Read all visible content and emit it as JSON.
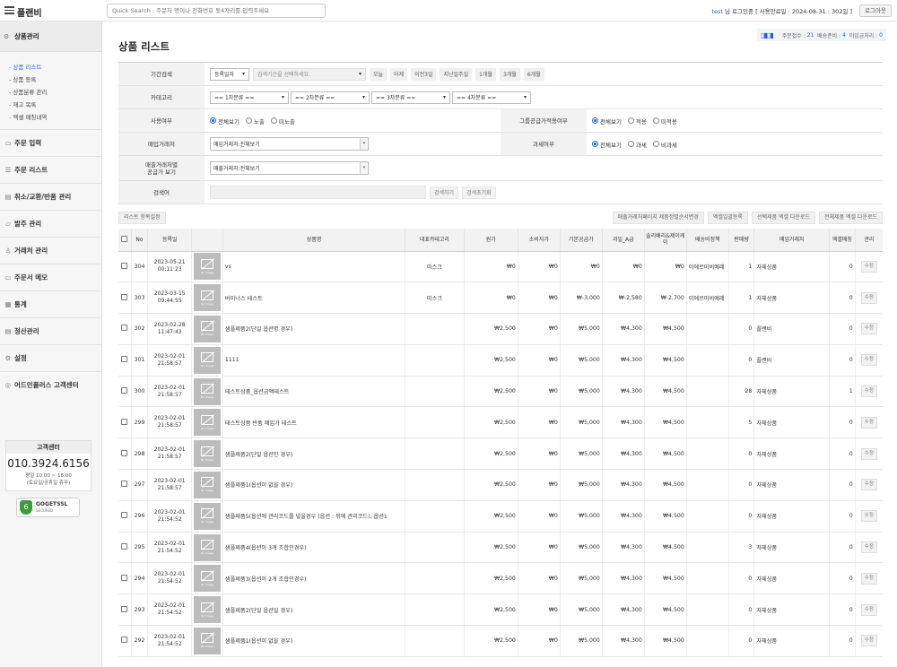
{
  "header": {
    "brand": "플랜비",
    "quick_search_placeholder": "Quick Search : 주문자 명이나 전화번호 뒷4자리를 입력주세요",
    "login_user": "test",
    "login_text": "님 로그인중 [ 사용만료일 : 2024-08-31 : 302일 ]",
    "logout_label": "로그아웃"
  },
  "sidebar": {
    "active_section": "상품관리",
    "sub_items": [
      "- 상품 리스트",
      "- 상품 등록",
      "- 상품분류 관리",
      "- 재고 목록",
      "- 엑셀 매칭내역"
    ],
    "items": [
      {
        "label": "주문 입력",
        "icon": "document-icon"
      },
      {
        "label": "주문 리스트",
        "icon": "list-icon"
      },
      {
        "label": "취소/교환/반품 관리",
        "icon": "return-icon"
      },
      {
        "label": "발주 관리",
        "icon": "order-icon"
      },
      {
        "label": "거래처 관리",
        "icon": "person-icon"
      },
      {
        "label": "주문서 메모",
        "icon": "memo-icon"
      },
      {
        "label": "통계",
        "icon": "chart-icon"
      },
      {
        "label": "정산관리",
        "icon": "calc-icon"
      },
      {
        "label": "설정",
        "icon": "gear-icon"
      },
      {
        "label": "어드민플러스 고객센터",
        "icon": "support-icon"
      }
    ],
    "cs": {
      "title": "고객센터",
      "phone": "010.3924.6156",
      "hours_line1": "평일 10:00 ~ 18:00",
      "hours_line2": "(토요일/공휴일 휴무)"
    },
    "ssl_badge": {
      "name": "GOGETSSL",
      "sub": "SECURED"
    }
  },
  "main": {
    "page_title": "상품 리스트",
    "status": {
      "order_count_label": "주문접수 :",
      "order_count": "21",
      "shipping_label": "배송준비 :",
      "shipping_count": "4",
      "unmatched_label": "미입금처리 :",
      "unmatched_count": "0"
    }
  },
  "filter": {
    "period_label": "기간검색",
    "period_select": "등록일자",
    "period_range_placeholder": "검색기간을 선택하세요.",
    "period_buttons": [
      "오늘",
      "어제",
      "이전3일",
      "지난일주일",
      "1개월",
      "3개월",
      "6개월"
    ],
    "category_label": "카테고리",
    "category_selects": [
      "== 1차분류 ==",
      "== 2차분류 ==",
      "== 3차분류 ==",
      "== 4차분류 =="
    ],
    "use_label": "사용여부",
    "use_options": [
      "전체보기",
      "노출",
      "미노출"
    ],
    "group_label": "그룹공급가적용여부",
    "group_options": [
      "전체보기",
      "적용",
      "미적용"
    ],
    "purchase_label": "매입거래처",
    "purchase_value": "매입거래처:전체보기",
    "tax_label": "과세여부",
    "tax_options": [
      "전체보기",
      "과세",
      "비과세"
    ],
    "sales_label_line1": "매출거래처별",
    "sales_label_line2": "공급가 보기",
    "sales_value": "매출거래처:전체보기",
    "keyword_label": "검색어",
    "search_button": "검색하기",
    "reset_button": "검색초기화"
  },
  "list_tools": {
    "column_settings": "리스트 항목설정",
    "right_buttons": [
      "매출거래처페이지 제품정렬순서변경",
      "엑셀일괄등록",
      "선택제품 엑셀 다운로드",
      "전체제품 엑셀 다운로드"
    ]
  },
  "table": {
    "headers": [
      "",
      "No",
      "등록일",
      "",
      "상품명",
      "대표카테고리",
      "원가",
      "소비자가",
      "기본공급가",
      "과일_A급",
      "솔리베리&제이케이",
      "배송비정책",
      "판매량",
      "매입거래처",
      "엑셀매칭",
      "관리"
    ],
    "no_image_text": "No Image",
    "edit_label": "수정",
    "rows": [
      {
        "no": "304",
        "date": "2023-05-21",
        "time": "00:11:23",
        "name": "vs",
        "category": "미스크",
        "cost": "₩0",
        "consumer": "₩0",
        "supply": "₩0",
        "grade_a": "₩0",
        "jk": "₩0",
        "ship": "이에르미비예레",
        "sold": "1",
        "vendor": "자체상품",
        "match": "0"
      },
      {
        "no": "303",
        "date": "2023-03-15",
        "time": "09:44:55",
        "name": "바이너스 테스트",
        "category": "미스크",
        "cost": "₩0",
        "consumer": "₩0",
        "supply": "₩-3,000",
        "grade_a": "₩-2,580",
        "jk": "₩-2,700",
        "ship": "이에르미비예레",
        "sold": "1",
        "vendor": "자체상품",
        "match": "0"
      },
      {
        "no": "302",
        "date": "2023-02-28",
        "time": "11:47:43",
        "name": "샘플제품2(단일 옵션명 경우)",
        "category": "",
        "cost": "₩2,500",
        "consumer": "₩0",
        "supply": "₩5,000",
        "grade_a": "₩4,300",
        "jk": "₩4,500",
        "ship": "",
        "sold": "0",
        "vendor": "플랜비",
        "match": "0"
      },
      {
        "no": "301",
        "date": "2023-02-01",
        "time": "21:58:57",
        "name": "1111",
        "category": "",
        "cost": "₩2,500",
        "consumer": "₩0",
        "supply": "₩5,000",
        "grade_a": "₩4,300",
        "jk": "₩4,500",
        "ship": "",
        "sold": "0",
        "vendor": "플랜비",
        "match": "0"
      },
      {
        "no": "300",
        "date": "2023-02-01",
        "time": "21:58:57",
        "name": "테스트상품_옵션금액테스트",
        "category": "",
        "cost": "₩2,500",
        "consumer": "₩0",
        "supply": "₩5,000",
        "grade_a": "₩4,300",
        "jk": "₩4,500",
        "ship": "",
        "sold": "28",
        "vendor": "자체상품",
        "match": "1"
      },
      {
        "no": "299",
        "date": "2023-02-01",
        "time": "21:58:57",
        "name": "테스트상품 반품 매입가 테스트",
        "category": "",
        "cost": "₩2,500",
        "consumer": "₩0",
        "supply": "₩5,000",
        "grade_a": "₩4,300",
        "jk": "₩4,500",
        "ship": "",
        "sold": "5",
        "vendor": "자체상품",
        "match": "0"
      },
      {
        "no": "298",
        "date": "2023-02-01",
        "time": "21:58:57",
        "name": "샘플제품2(단일 옵션인 경우)",
        "category": "",
        "cost": "₩2,500",
        "consumer": "₩0",
        "supply": "₩5,000",
        "grade_a": "₩4,300",
        "jk": "₩4,500",
        "ship": "",
        "sold": "0",
        "vendor": "자체상품",
        "match": "0"
      },
      {
        "no": "297",
        "date": "2023-02-01",
        "time": "21:58:57",
        "name": "샘플제품1(옵션이 없을 경우)",
        "category": "",
        "cost": "₩2,500",
        "consumer": "₩0",
        "supply": "₩5,000",
        "grade_a": "₩4,300",
        "jk": "₩4,500",
        "ship": "",
        "sold": "0",
        "vendor": "자체상품",
        "match": "0"
      },
      {
        "no": "296",
        "date": "2023-02-01",
        "time": "21:54:52",
        "name": "샘플제품5(옵션에 관리코드를 넣을경우 (옵션 : 뒤에 관리코드), 옵션1",
        "category": "",
        "cost": "₩2,500",
        "consumer": "₩0",
        "supply": "₩5,000",
        "grade_a": "₩4,300",
        "jk": "₩4,500",
        "ship": "",
        "sold": "0",
        "vendor": "자체상품",
        "match": "0"
      },
      {
        "no": "295",
        "date": "2023-02-01",
        "time": "21:54:52",
        "name": "샘플제품4(옵션이 3개 조합인경우)",
        "category": "",
        "cost": "₩2,500",
        "consumer": "₩0",
        "supply": "₩5,000",
        "grade_a": "₩4,300",
        "jk": "₩4,500",
        "ship": "",
        "sold": "3",
        "vendor": "자체상품",
        "match": "0"
      },
      {
        "no": "294",
        "date": "2023-02-01",
        "time": "21:54:52",
        "name": "샘플제품3(옵션이 2개 조합인경우)",
        "category": "",
        "cost": "₩2,500",
        "consumer": "₩0",
        "supply": "₩5,000",
        "grade_a": "₩4,300",
        "jk": "₩4,500",
        "ship": "",
        "sold": "0",
        "vendor": "자체상품",
        "match": "0"
      },
      {
        "no": "293",
        "date": "2023-02-01",
        "time": "21:54:52",
        "name": "샘플제품2(단일 옵션일 경우)",
        "category": "",
        "cost": "₩2,500",
        "consumer": "₩0",
        "supply": "₩5,000",
        "grade_a": "₩4,300",
        "jk": "₩4,500",
        "ship": "",
        "sold": "0",
        "vendor": "자체상품",
        "match": "0"
      },
      {
        "no": "292",
        "date": "2023-02-01",
        "time": "21:54:52",
        "name": "샘플제품1(옵션이 없을 경우)",
        "category": "",
        "cost": "₩2,500",
        "consumer": "₩0",
        "supply": "₩5,000",
        "grade_a": "₩4,300",
        "jk": "₩4,500",
        "ship": "",
        "sold": "0",
        "vendor": "자체상품",
        "match": "0"
      }
    ]
  }
}
